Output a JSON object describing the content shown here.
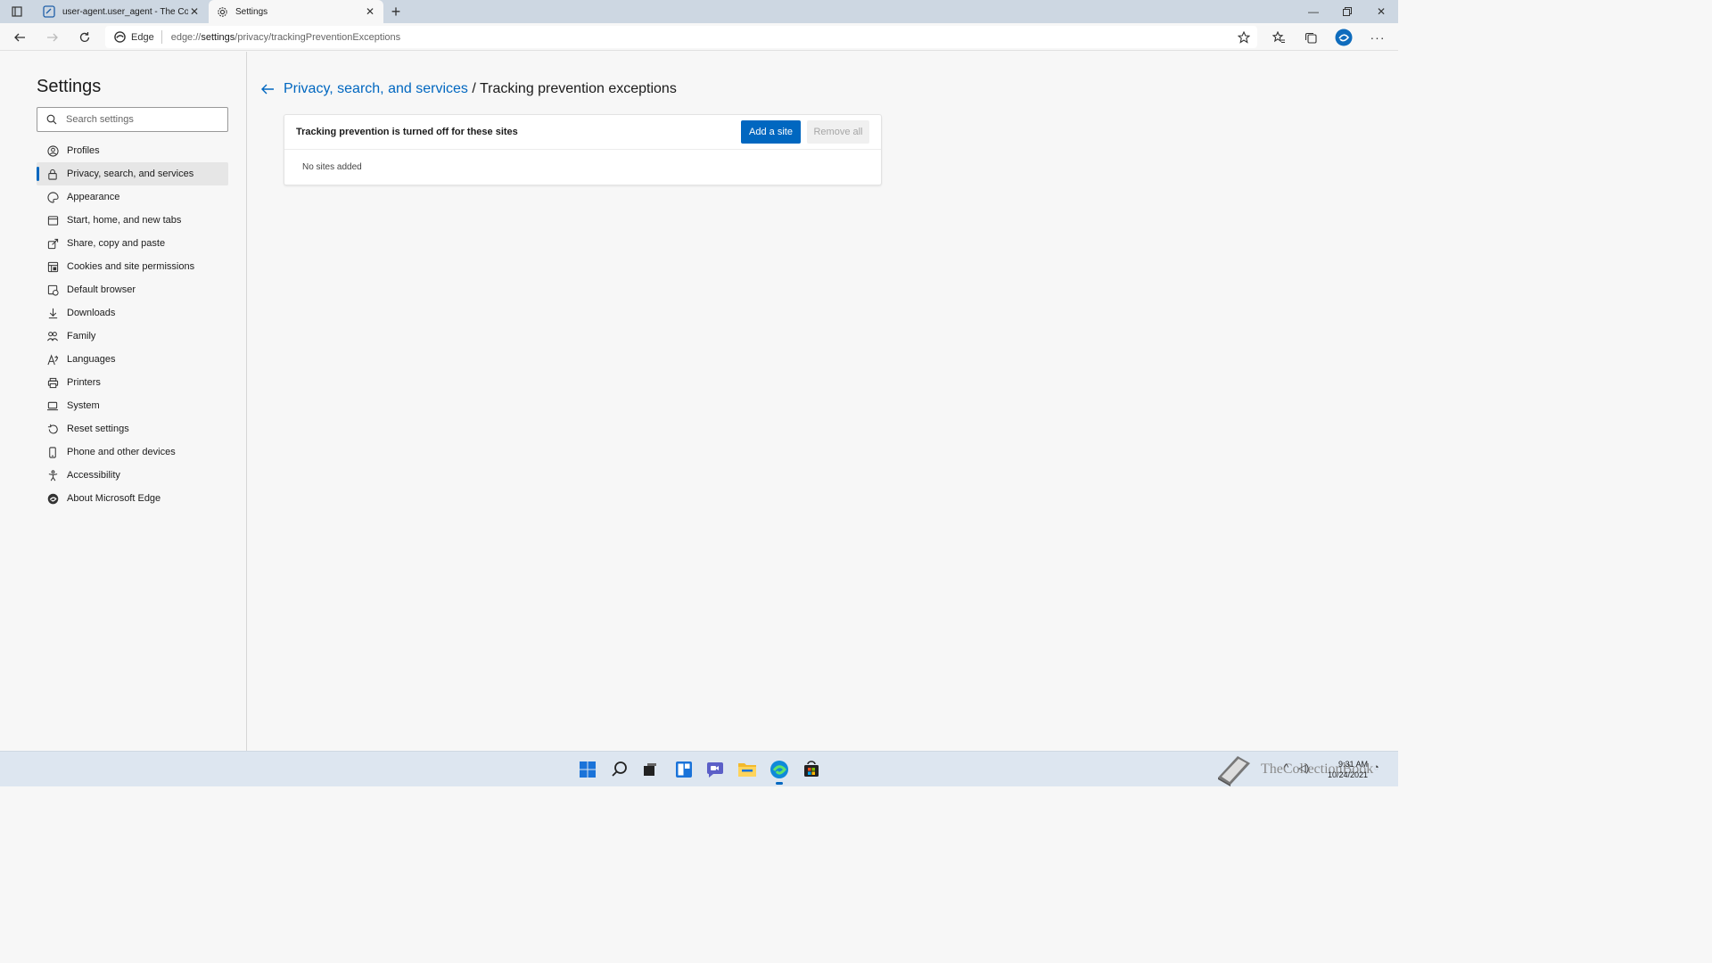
{
  "browser": {
    "tabs": [
      {
        "title": "user-agent.user_agent - The Coll",
        "active": false
      },
      {
        "title": "Settings",
        "active": true
      }
    ],
    "address": {
      "site_label": "Edge",
      "url_prefix": "edge://",
      "url_host": "settings",
      "url_path": "/privacy/trackingPreventionExceptions"
    }
  },
  "sidebar": {
    "title": "Settings",
    "search_placeholder": "Search settings",
    "items": [
      {
        "label": "Profiles",
        "icon": "profile-icon"
      },
      {
        "label": "Privacy, search, and services",
        "icon": "lock-icon",
        "selected": true
      },
      {
        "label": "Appearance",
        "icon": "palette-icon"
      },
      {
        "label": "Start, home, and new tabs",
        "icon": "home-tabs-icon"
      },
      {
        "label": "Share, copy and paste",
        "icon": "share-icon"
      },
      {
        "label": "Cookies and site permissions",
        "icon": "cookies-icon"
      },
      {
        "label": "Default browser",
        "icon": "default-browser-icon"
      },
      {
        "label": "Downloads",
        "icon": "download-icon"
      },
      {
        "label": "Family",
        "icon": "family-icon"
      },
      {
        "label": "Languages",
        "icon": "languages-icon"
      },
      {
        "label": "Printers",
        "icon": "printer-icon"
      },
      {
        "label": "System",
        "icon": "system-icon"
      },
      {
        "label": "Reset settings",
        "icon": "reset-icon"
      },
      {
        "label": "Phone and other devices",
        "icon": "phone-icon"
      },
      {
        "label": "Accessibility",
        "icon": "accessibility-icon"
      },
      {
        "label": "About Microsoft Edge",
        "icon": "edge-logo-icon"
      }
    ]
  },
  "main": {
    "breadcrumb_parent": "Privacy, search, and services",
    "breadcrumb_separator": "/",
    "breadcrumb_current": "Tracking prevention exceptions",
    "card": {
      "heading": "Tracking prevention is turned off for these sites",
      "add_button": "Add a site",
      "remove_button": "Remove all",
      "empty_text": "No sites added"
    }
  },
  "taskbar": {
    "watermark_text": "TheCollectionBook",
    "time": "9:31 AM",
    "date": "10/24/2021"
  },
  "colors": {
    "accent": "#0067c0",
    "taskbar_bg": "#dde6f0",
    "tabstrip_bg": "#cdd7e2"
  }
}
